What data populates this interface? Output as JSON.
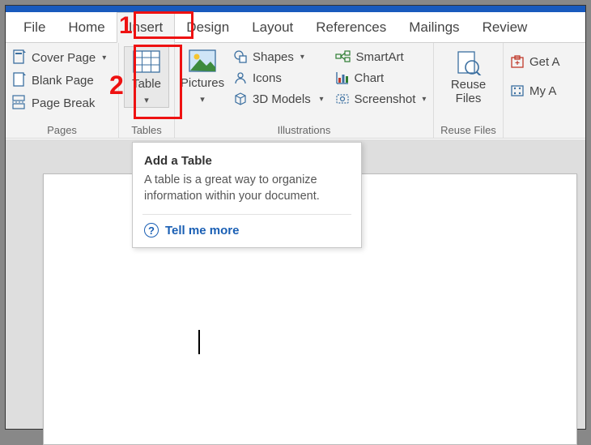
{
  "annotations": {
    "step1": "1",
    "step2": "2"
  },
  "tabs": {
    "file": "File",
    "home": "Home",
    "insert": "Insert",
    "design": "Design",
    "layout": "Layout",
    "references": "References",
    "mailings": "Mailings",
    "review": "Review"
  },
  "ribbon": {
    "pages": {
      "label": "Pages",
      "cover_page": "Cover Page",
      "blank_page": "Blank Page",
      "page_break": "Page Break"
    },
    "tables": {
      "label": "Tables",
      "table": "Table"
    },
    "illustrations": {
      "label": "Illustrations",
      "pictures": "Pictures",
      "shapes": "Shapes",
      "icons": "Icons",
      "models": "3D Models",
      "smartart": "SmartArt",
      "chart": "Chart",
      "screenshot": "Screenshot"
    },
    "reuse": {
      "label": "Reuse Files",
      "reuse_files": "Reuse\nFiles"
    },
    "right": {
      "get_addins": "Get A",
      "my_addins": "My A"
    }
  },
  "tooltip": {
    "title": "Add a Table",
    "body": "A table is a great way to organize information within your document.",
    "link": "Tell me more"
  }
}
